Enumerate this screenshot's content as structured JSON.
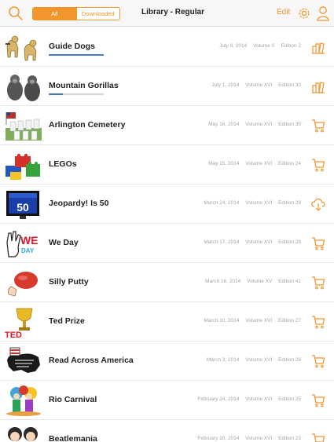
{
  "header": {
    "segments": [
      "All",
      "Downloaded"
    ],
    "title": "Library - Regular",
    "edit_label": "Edit",
    "accent": "#f2952b"
  },
  "items": [
    {
      "title": "Guide Dogs",
      "date": "July 8, 2014",
      "volume": "Volume S",
      "edition": "Edition 2",
      "action": "library-icon",
      "progress": 1.0
    },
    {
      "title": "Mountain Gorillas",
      "date": "July 1, 2014",
      "volume": "Volume XVI",
      "edition": "Edition 30",
      "action": "library-icon",
      "progress": 0.25
    },
    {
      "title": "Arlington Cemetery",
      "date": "May 16, 2014",
      "volume": "Volume XVI",
      "edition": "Edition 35",
      "action": "cart-icon"
    },
    {
      "title": "LEGOs",
      "date": "May 15, 2014",
      "volume": "Volume XVI",
      "edition": "Edition 24",
      "action": "cart-icon"
    },
    {
      "title": "Jeopardy! Is 50",
      "date": "March 24, 2014",
      "volume": "Volume XVI",
      "edition": "Edition 29",
      "action": "cloud-download-icon"
    },
    {
      "title": "We Day",
      "date": "March 17, 2014",
      "volume": "Volume XVI",
      "edition": "Edition 28",
      "action": "cart-icon"
    },
    {
      "title": "Silly Putty",
      "date": "March 16, 2014",
      "volume": "Volume XV",
      "edition": "Edition 41",
      "action": "cart-icon"
    },
    {
      "title": "Ted Prize",
      "date": "March 10, 2014",
      "volume": "Volume XVI",
      "edition": "Edition 27",
      "action": "cart-icon"
    },
    {
      "title": "Read Across America",
      "date": "March 3, 2014",
      "volume": "Volume XVI",
      "edition": "Edition 26",
      "action": "cart-icon"
    },
    {
      "title": "Rio Carnival",
      "date": "February 24, 2014",
      "volume": "Volume XVI",
      "edition": "Edition 25",
      "action": "cart-icon"
    },
    {
      "title": "Beatlemania",
      "date": "February 10, 2014",
      "volume": "Volume XVI",
      "edition": "Edition 23",
      "action": "cart-icon"
    }
  ],
  "thumb_badges": {
    "jeopardy": "50",
    "weday_we": "WE",
    "weday_day": "DAY",
    "ted": "TED"
  }
}
